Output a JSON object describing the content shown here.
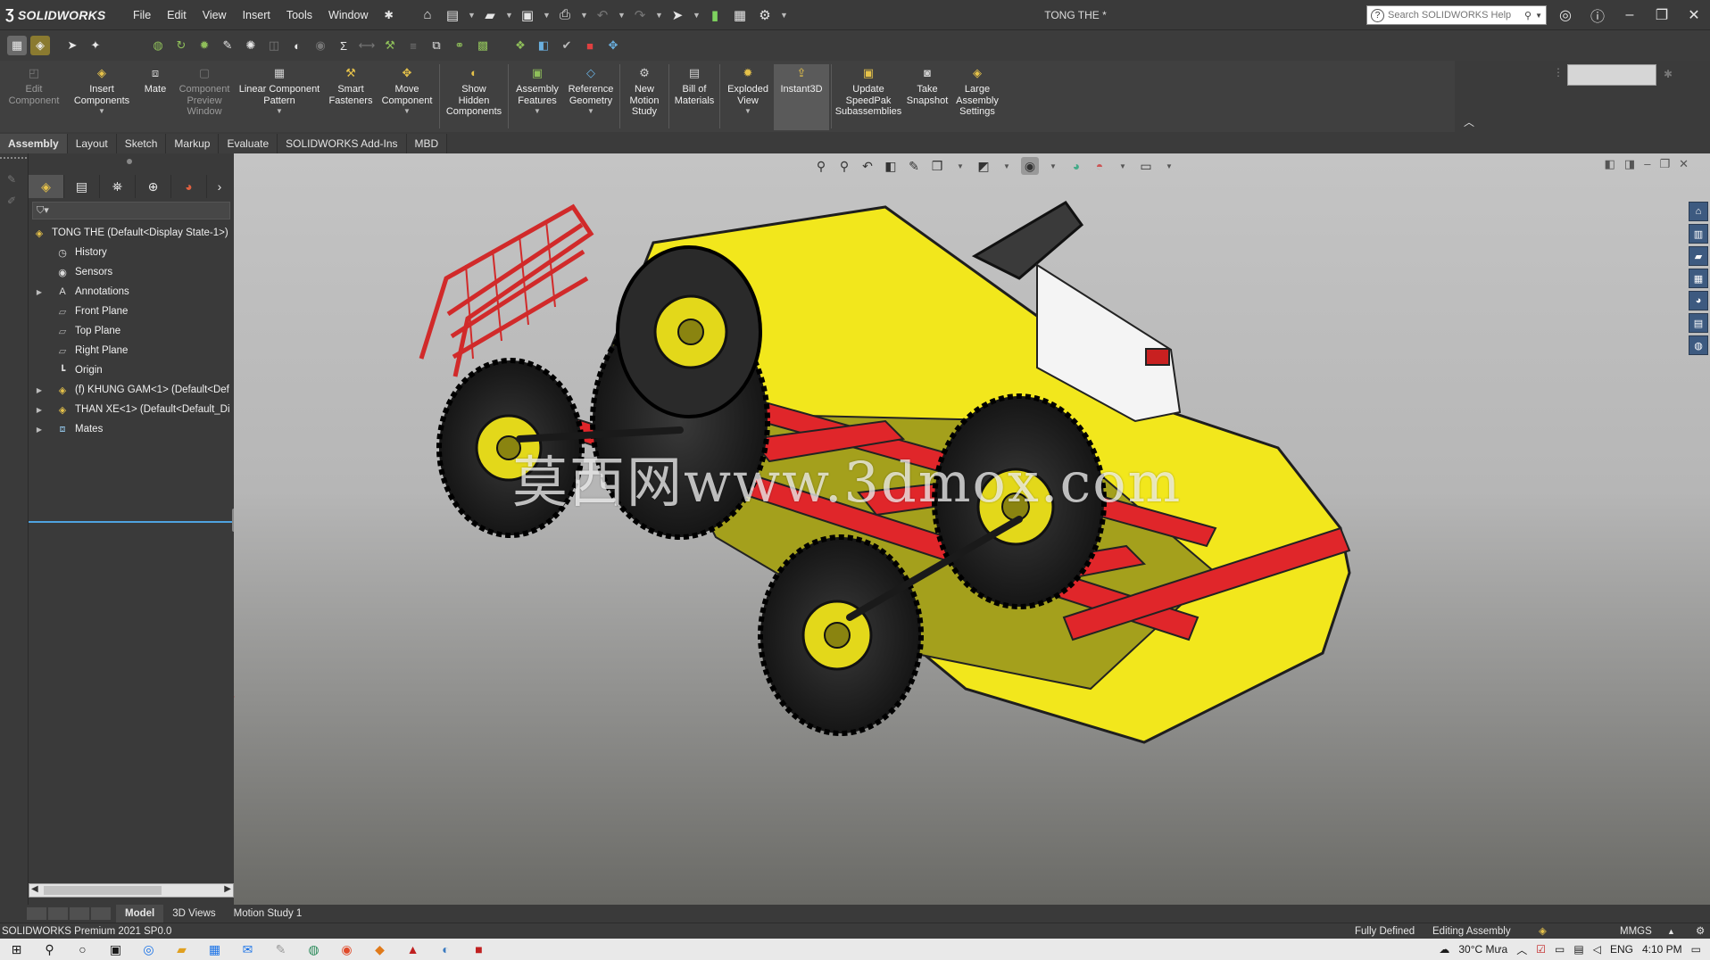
{
  "app": {
    "name": "SOLIDWORKS",
    "document_title": "TONG THE *",
    "menus": [
      "File",
      "Edit",
      "View",
      "Insert",
      "Tools",
      "Window"
    ],
    "search_placeholder": "Search SOLIDWORKS Help",
    "brand_color": "#d9262e",
    "accent_color": "#4fa3e0"
  },
  "command_manager": {
    "commands": [
      {
        "label": "Edit\nComponent",
        "icon": "edit-component-icon",
        "enabled": false
      },
      {
        "label": "Insert\nComponents",
        "icon": "insert-components-icon",
        "enabled": true
      },
      {
        "label": "Mate",
        "icon": "mate-icon",
        "enabled": true
      },
      {
        "label": "Component\nPreview\nWindow",
        "icon": "component-preview-icon",
        "enabled": false
      },
      {
        "label": "Linear Component\nPattern",
        "icon": "linear-pattern-icon",
        "enabled": true
      },
      {
        "label": "Smart\nFasteners",
        "icon": "smart-fasteners-icon",
        "enabled": true
      },
      {
        "label": "Move\nComponent",
        "icon": "move-component-icon",
        "enabled": true
      },
      {
        "label": "Show\nHidden\nComponents",
        "icon": "show-hidden-icon",
        "enabled": true
      },
      {
        "label": "Assembly\nFeatures",
        "icon": "assembly-features-icon",
        "enabled": true
      },
      {
        "label": "Reference\nGeometry",
        "icon": "reference-geometry-icon",
        "enabled": true
      },
      {
        "label": "New\nMotion\nStudy",
        "icon": "motion-study-icon",
        "enabled": true
      },
      {
        "label": "Bill of\nMaterials",
        "icon": "bom-icon",
        "enabled": true
      },
      {
        "label": "Exploded\nView",
        "icon": "exploded-view-icon",
        "enabled": true
      },
      {
        "label": "Instant3D",
        "icon": "instant3d-icon",
        "enabled": true
      },
      {
        "label": "Update\nSpeedPak\nSubassemblies",
        "icon": "speedpak-icon",
        "enabled": true
      },
      {
        "label": "Take\nSnapshot",
        "icon": "snapshot-icon",
        "enabled": true
      },
      {
        "label": "Large\nAssembly\nSettings",
        "icon": "large-assembly-icon",
        "enabled": true
      }
    ]
  },
  "tabs": [
    "Assembly",
    "Layout",
    "Sketch",
    "Markup",
    "Evaluate",
    "SOLIDWORKS Add-Ins",
    "MBD"
  ],
  "feature_tree": {
    "root": "TONG THE  (Default<Display State-1>)",
    "items": [
      {
        "label": "History",
        "icon": "history-icon",
        "expandable": false
      },
      {
        "label": "Sensors",
        "icon": "sensors-icon",
        "expandable": false
      },
      {
        "label": "Annotations",
        "icon": "annotations-icon",
        "expandable": true
      },
      {
        "label": "Front Plane",
        "icon": "plane-icon",
        "expandable": false
      },
      {
        "label": "Top Plane",
        "icon": "plane-icon",
        "expandable": false
      },
      {
        "label": "Right Plane",
        "icon": "plane-icon",
        "expandable": false
      },
      {
        "label": "Origin",
        "icon": "origin-icon",
        "expandable": false
      },
      {
        "label": "(f) KHUNG GAM<1> (Default<Def",
        "icon": "assembly-icon",
        "expandable": true
      },
      {
        "label": "THAN XE<1> (Default<Default_Di",
        "icon": "assembly-icon",
        "expandable": true
      },
      {
        "label": "Mates",
        "icon": "mates-icon",
        "expandable": true
      }
    ]
  },
  "viewport": {
    "watermark": "莫西网www.3dmox.com",
    "body_color": "#f2e71c",
    "frame_color": "#e0262a",
    "tire_color": "#2a2a2a"
  },
  "bottom_tabs": [
    "Model",
    "3D Views",
    "Motion Study 1"
  ],
  "status": {
    "version": "SOLIDWORKS Premium 2021 SP0.0",
    "state": "Fully Defined",
    "mode": "Editing Assembly",
    "units": "MMGS"
  },
  "taskbar": {
    "weather": "30°C  Mưa",
    "language": "ENG",
    "time": "4:10 PM"
  }
}
